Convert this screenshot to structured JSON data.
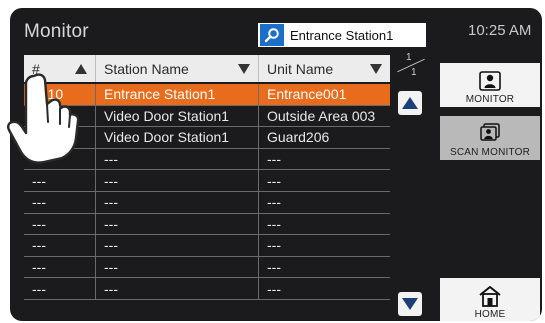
{
  "header": {
    "title": "Monitor",
    "search_value": "Entrance Station1",
    "clock": "10:25 AM"
  },
  "table": {
    "columns": [
      {
        "label": "#",
        "sort": "asc"
      },
      {
        "label": "Station Name",
        "sort": "desc"
      },
      {
        "label": "Unit Name",
        "sort": "desc"
      }
    ],
    "rows": [
      {
        "num": "0010",
        "station": "Entrance Station1",
        "unit": "Entrance001",
        "selected": true
      },
      {
        "num": "0030",
        "station": "Video Door Station1",
        "unit": "Outside Area 003",
        "selected": false
      },
      {
        "num": "0052",
        "station": "Video Door Station1",
        "unit": "Guard206",
        "selected": false
      },
      {
        "num": "---",
        "station": "---",
        "unit": "---",
        "selected": false
      },
      {
        "num": "---",
        "station": "---",
        "unit": "---",
        "selected": false
      },
      {
        "num": "---",
        "station": "---",
        "unit": "---",
        "selected": false
      },
      {
        "num": "---",
        "station": "---",
        "unit": "---",
        "selected": false
      },
      {
        "num": "---",
        "station": "---",
        "unit": "---",
        "selected": false
      },
      {
        "num": "---",
        "station": "---",
        "unit": "---",
        "selected": false
      },
      {
        "num": "---",
        "station": "---",
        "unit": "---",
        "selected": false
      }
    ]
  },
  "pager": {
    "current": "1",
    "total": "1"
  },
  "side": {
    "monitor_label": "MONITOR",
    "scan_label": "SCAN MONITOR",
    "home_label": "HOME"
  },
  "colors": {
    "selected_row": "#e96c1d",
    "screen_bg": "#1b1b1d",
    "accent_blue": "#1c6fc9"
  }
}
